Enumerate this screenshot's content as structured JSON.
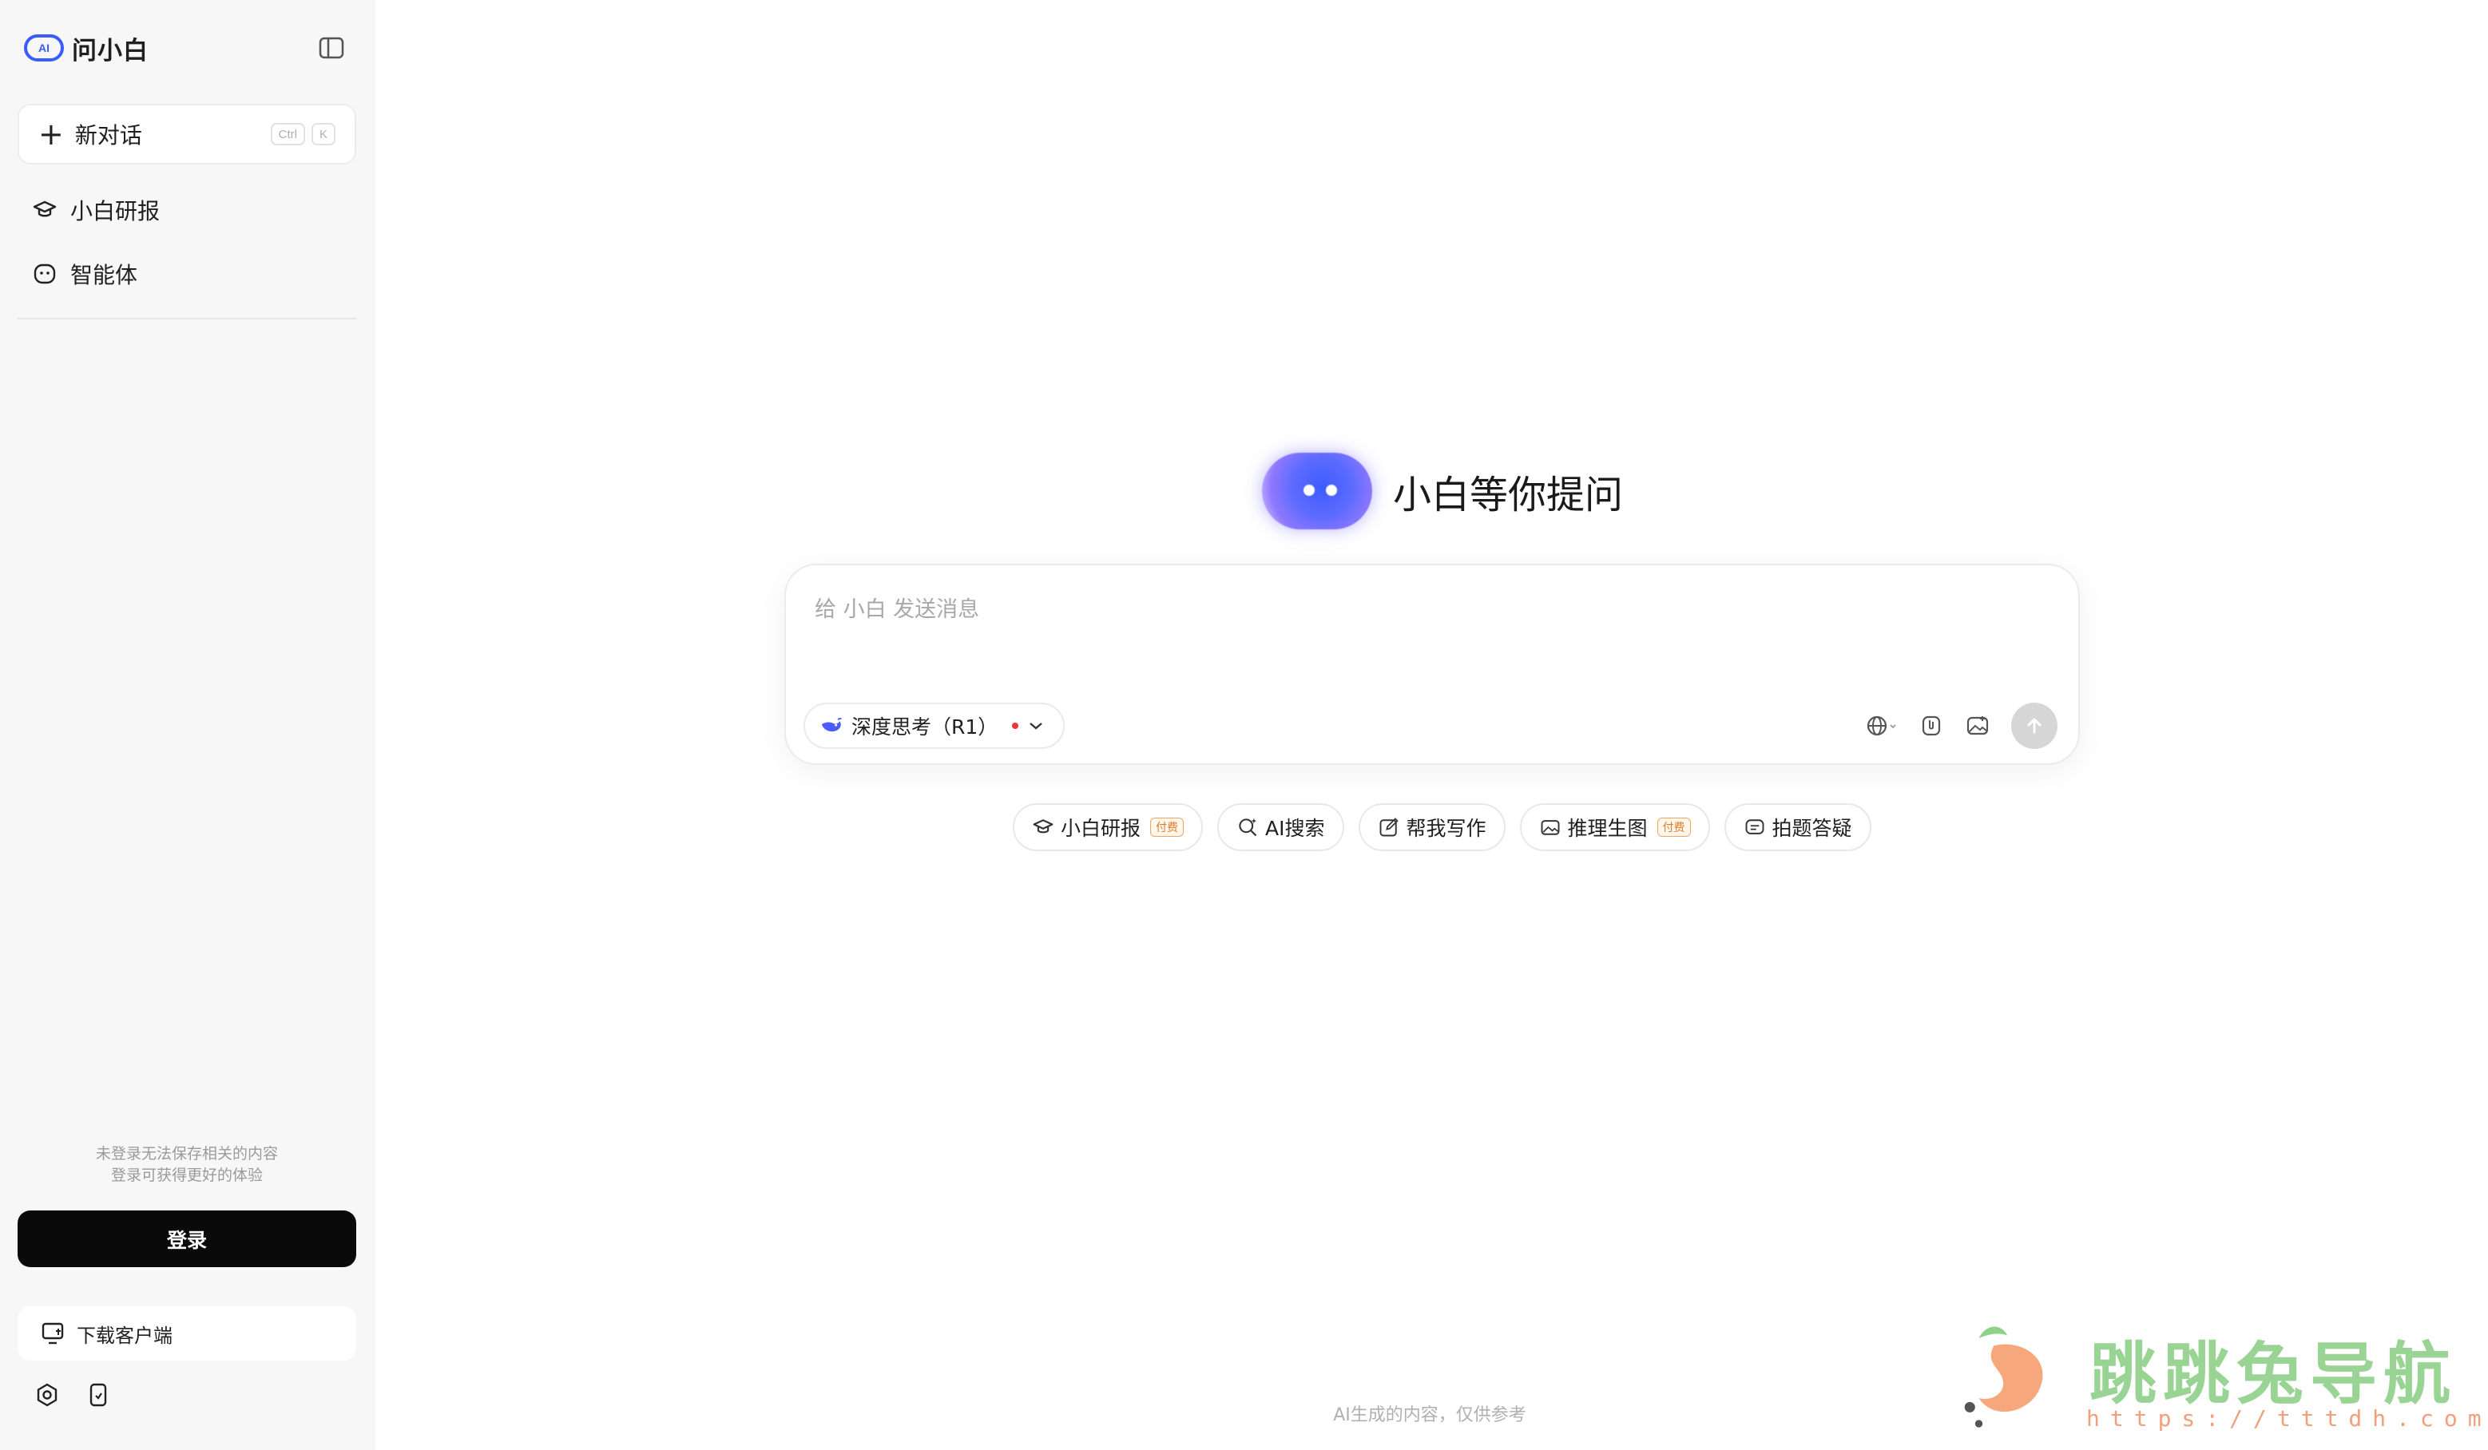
{
  "app": {
    "name": "问小白"
  },
  "sidebar": {
    "new_chat": {
      "label": "新对话",
      "shortcut": [
        "Ctrl",
        "K"
      ]
    },
    "items": [
      {
        "label": "小白研报",
        "icon": "graduation-cap-icon"
      },
      {
        "label": "智能体",
        "icon": "bot-face-icon"
      }
    ],
    "login_hint_line1": "未登录无法保存相关的内容",
    "login_hint_line2": "登录可获得更好的体验",
    "login_label": "登录",
    "download_label": "下载客户端"
  },
  "main": {
    "hero_title": "小白等你提问",
    "composer": {
      "placeholder": "给 小白 发送消息",
      "model_label": "深度思考（R1）"
    },
    "chips": [
      {
        "label": "小白研报",
        "tag": "付费",
        "icon": "graduation-cap-icon"
      },
      {
        "label": "AI搜索",
        "tag": "",
        "icon": "search-sparkle-icon"
      },
      {
        "label": "帮我写作",
        "tag": "",
        "icon": "edit-icon"
      },
      {
        "label": "推理生图",
        "tag": "付费",
        "icon": "image-icon"
      },
      {
        "label": "拍题答疑",
        "tag": "",
        "icon": "chat-icon"
      }
    ],
    "footer_note": "AI生成的内容，仅供参考"
  },
  "watermark": {
    "text": "跳跳兔导航",
    "url": "https://tttdh.com"
  },
  "colors": {
    "accent": "#4a5cff",
    "login_bg": "#0a0a0a",
    "tag": "#e07b2e",
    "sidebar_bg": "#f7f7f8"
  }
}
